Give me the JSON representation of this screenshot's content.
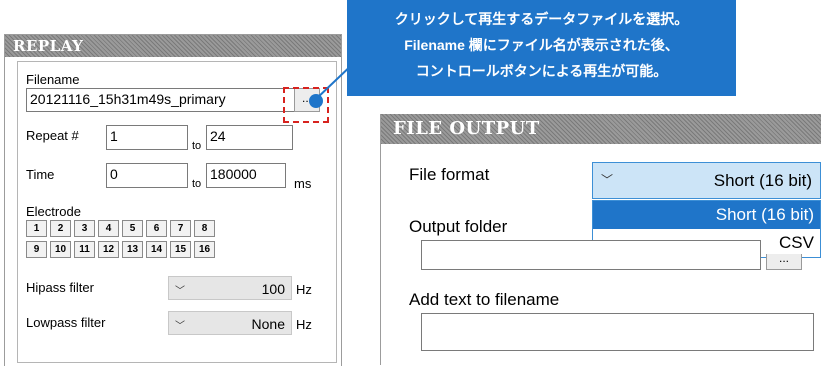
{
  "replay": {
    "title": "REPLAY",
    "filename_label": "Filename",
    "filename_value": "20121116_15h31m49s_primary",
    "browse_label": "...",
    "repeat_label": "Repeat #",
    "repeat_from": "1",
    "repeat_to_label": "to",
    "repeat_to": "24",
    "time_label": "Time",
    "time_from": "0",
    "time_to_label": "to",
    "time_to": "180000",
    "time_unit": "ms",
    "electrode_label": "Electrode",
    "electrodes": [
      "1",
      "2",
      "3",
      "4",
      "5",
      "6",
      "7",
      "8",
      "9",
      "10",
      "11",
      "12",
      "13",
      "14",
      "15",
      "16"
    ],
    "hipass_label": "Hipass filter",
    "hipass_value": "100",
    "hipass_unit": "Hz",
    "lowpass_label": "Lowpass filter",
    "lowpass_value": "None",
    "lowpass_unit": "Hz"
  },
  "callout": {
    "line1": "クリックして再生するデータファイルを選択。",
    "line2": "Filename 欄にファイル名が表示された後、",
    "line3": "コントロールボタンによる再生が可能。"
  },
  "file_output": {
    "title": "FILE OUTPUT",
    "format_label": "File format",
    "format_selected": "Short (16 bit)",
    "format_options": [
      "Short (16 bit)",
      "CSV"
    ],
    "folder_label": "Output folder",
    "folder_value": "",
    "folder_browse": "...",
    "addtext_label": "Add text to filename",
    "addtext_value": ""
  },
  "colors": {
    "callout_bg": "#1f75c9",
    "highlight": "#d7231f",
    "dropdown_selected": "#1f75c9"
  }
}
